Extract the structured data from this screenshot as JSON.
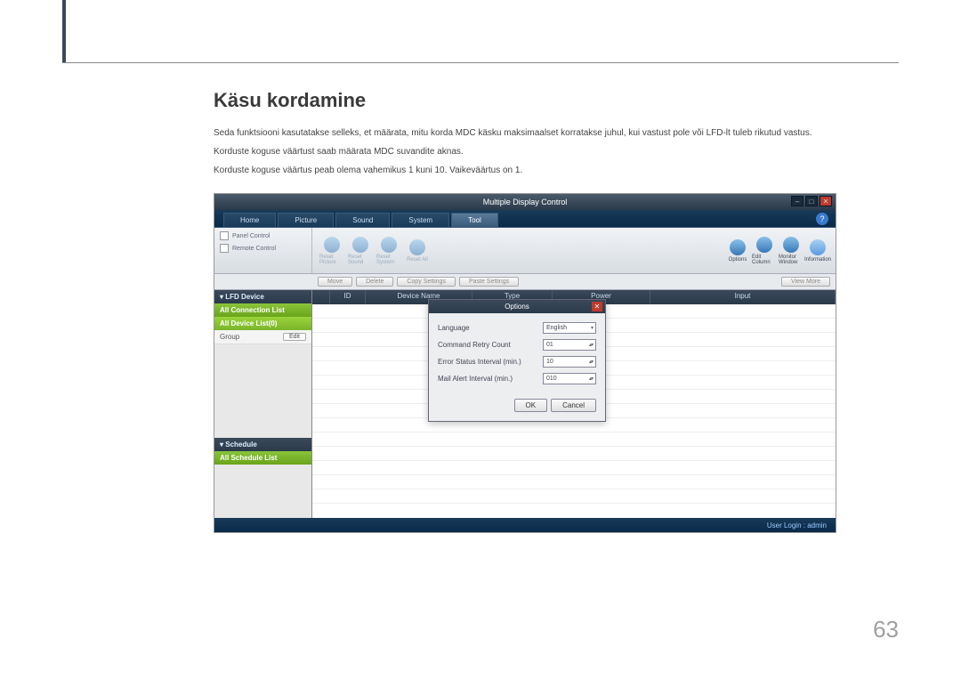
{
  "heading": "Käsu kordamine",
  "paragraphs": [
    "Seda funktsiooni kasutatakse selleks, et määrata, mitu korda MDC käsku maksimaalset korratakse juhul, kui vastust pole või LFD-lt tuleb rikutud vastus.",
    "Korduste koguse väärtust saab määrata MDC suvandite aknas.",
    "Korduste koguse väärtus peab olema vahemikus 1 kuni 10. Vaikeväärtus on 1."
  ],
  "page_number": "63",
  "app": {
    "title": "Multiple Display Control",
    "tabs": [
      "Home",
      "Picture",
      "Sound",
      "System",
      "Tool"
    ],
    "active_tab": "Tool",
    "panel_rows": [
      "Panel Control",
      "Remote Control"
    ],
    "tool_icons_left": [
      "Reset Picture",
      "Reset Sound",
      "Reset System",
      "Reset All"
    ],
    "tool_icons_right": [
      "Options",
      "Edit Column",
      "Monitor Window",
      "Information"
    ],
    "sub_buttons": [
      "Move",
      "Delete",
      "Copy Settings",
      "Paste Settings"
    ],
    "sub_right": "View More",
    "sidebar": {
      "lfd_head": "▾ LFD Device",
      "conn_list": "All Connection List",
      "dev_list": "All Device List(0)",
      "group_label": "Group",
      "edit_btn": "Edit",
      "sched_head": "▾ Schedule",
      "sched_list": "All Schedule List"
    },
    "columns": [
      "ID",
      "Device Name",
      "Type",
      "Power",
      "Input"
    ],
    "footer": "User Login : admin",
    "dialog": {
      "title": "Options",
      "rows": [
        {
          "label": "Language",
          "value": "English",
          "type": "select"
        },
        {
          "label": "Command Retry Count",
          "value": "01",
          "type": "spin"
        },
        {
          "label": "Error Status Interval (min.)",
          "value": "10",
          "type": "spin"
        },
        {
          "label": "Mail Alert Interval (min.)",
          "value": "010",
          "type": "spin"
        }
      ],
      "ok": "OK",
      "cancel": "Cancel"
    }
  }
}
